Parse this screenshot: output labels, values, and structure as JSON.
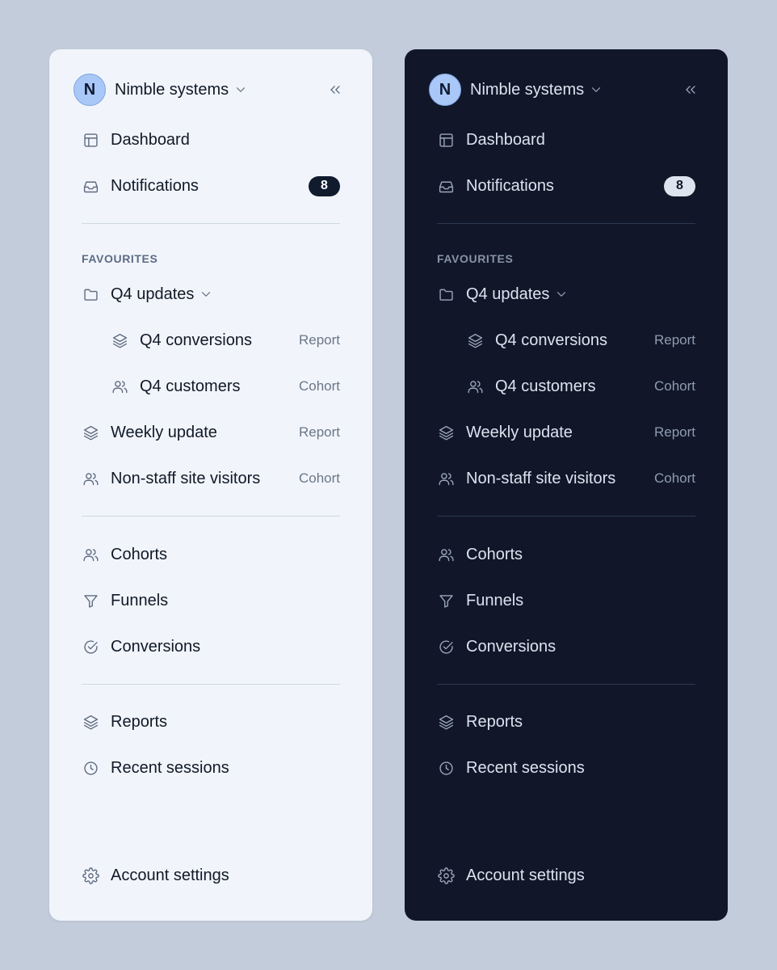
{
  "workspace": {
    "initial": "N",
    "name": "Nimble systems"
  },
  "nav": {
    "dashboard": "Dashboard",
    "notifications": "Notifications",
    "notifications_count": "8"
  },
  "favourites": {
    "heading": "FAVOURITES",
    "folder": "Q4 updates",
    "items": [
      {
        "label": "Q4 conversions",
        "type": "Report",
        "icon": "layers-icon"
      },
      {
        "label": "Q4 customers",
        "type": "Cohort",
        "icon": "users-icon"
      },
      {
        "label": "Weekly update",
        "type": "Report",
        "icon": "layers-icon"
      },
      {
        "label": "Non-staff site visitors",
        "type": "Cohort",
        "icon": "users-icon"
      }
    ]
  },
  "tools": {
    "cohorts": "Cohorts",
    "funnels": "Funnels",
    "conversions": "Conversions"
  },
  "history": {
    "reports": "Reports",
    "recent_sessions": "Recent sessions"
  },
  "footer": {
    "account_settings": "Account settings"
  },
  "colors": {
    "page_bg": "#c3ccdb",
    "light_panel": "#f1f5fb",
    "dark_panel": "#111729",
    "avatar": "#a9c8f7"
  }
}
